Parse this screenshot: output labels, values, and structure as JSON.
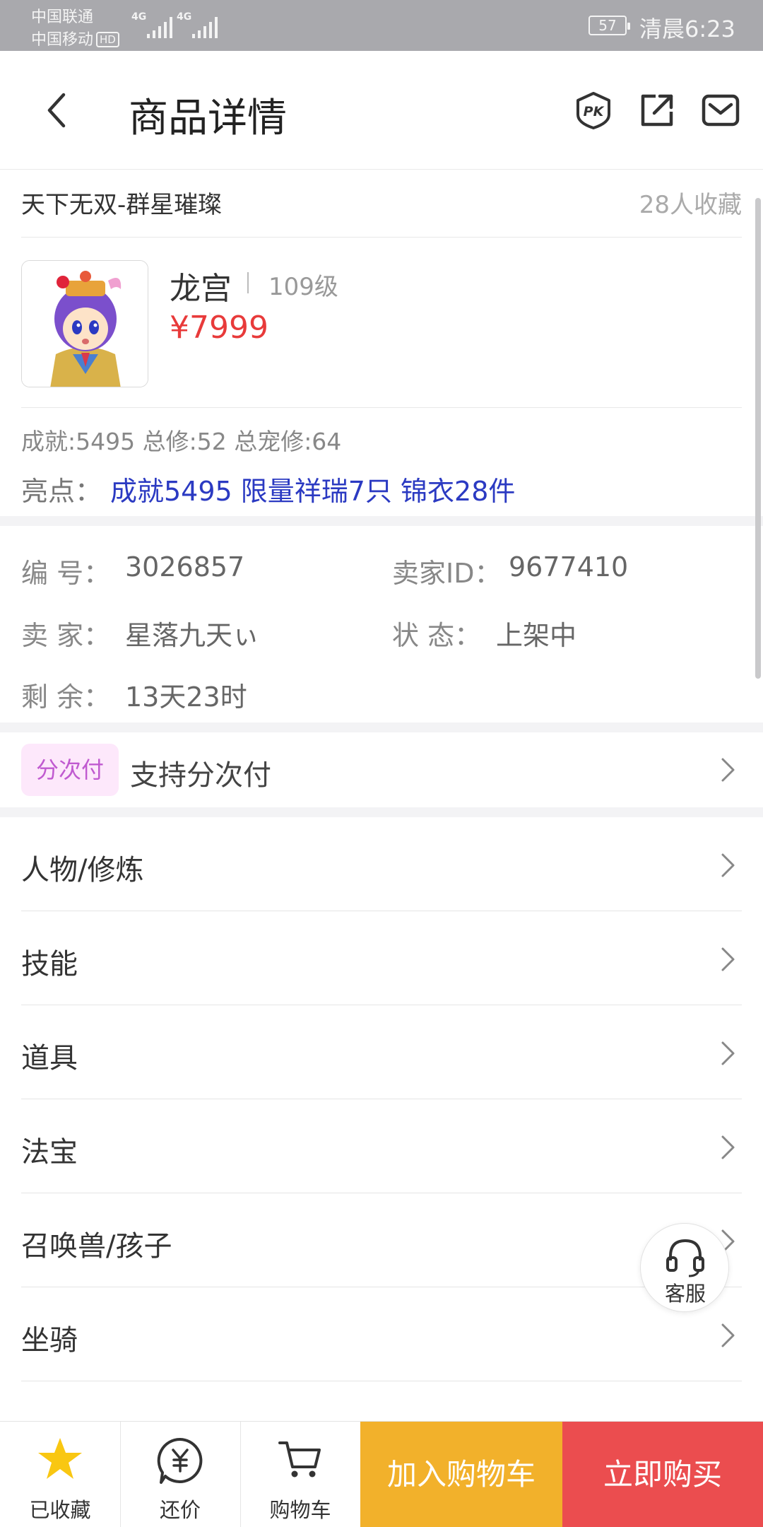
{
  "status_bar": {
    "carrier1": "中国联通",
    "carrier2": "中国移动",
    "hd": "HD",
    "network1": "4G",
    "network2": "4G",
    "battery": "57",
    "time": "清晨6:23"
  },
  "header": {
    "title": "商品详情"
  },
  "product": {
    "title": "天下无双-群星璀璨",
    "favorites": "28人收藏",
    "role": "龙宫",
    "level": "109级",
    "price": "¥7999",
    "stats": "成就:5495 总修:52 总宠修:64",
    "highlight_label": "亮点：",
    "highlight_value": "成就5495 限量祥瑞7只 锦衣28件"
  },
  "info": {
    "number_label": "编  号：",
    "number_value": "3026857",
    "seller_id_label": "卖家ID：",
    "seller_id_value": "9677410",
    "seller_label": "卖  家：",
    "seller_value": "星落九天ぃ",
    "status_label": "状  态：",
    "status_value": "上架中",
    "remaining_label": "剩  余：",
    "remaining_value": "13天23时"
  },
  "installment": {
    "badge": "分次付",
    "text": "支持分次付"
  },
  "menu": [
    {
      "label": "人物/修炼"
    },
    {
      "label": "技能"
    },
    {
      "label": "道具"
    },
    {
      "label": "法宝"
    },
    {
      "label": "召唤兽/孩子"
    },
    {
      "label": "坐骑"
    }
  ],
  "service": {
    "label": "客服"
  },
  "bottom_bar": {
    "favorited": "已收藏",
    "bargain": "还价",
    "cart": "购物车",
    "add_to_cart": "加入购物车",
    "buy_now": "立即购买"
  },
  "colors": {
    "price": "#e83a3a",
    "highlight": "#2b3ac2",
    "add_to_cart": "#f2b12b",
    "buy_now": "#eb4d4f",
    "installment_badge_bg": "#fde8fb",
    "installment_badge_text": "#c05ad0"
  }
}
